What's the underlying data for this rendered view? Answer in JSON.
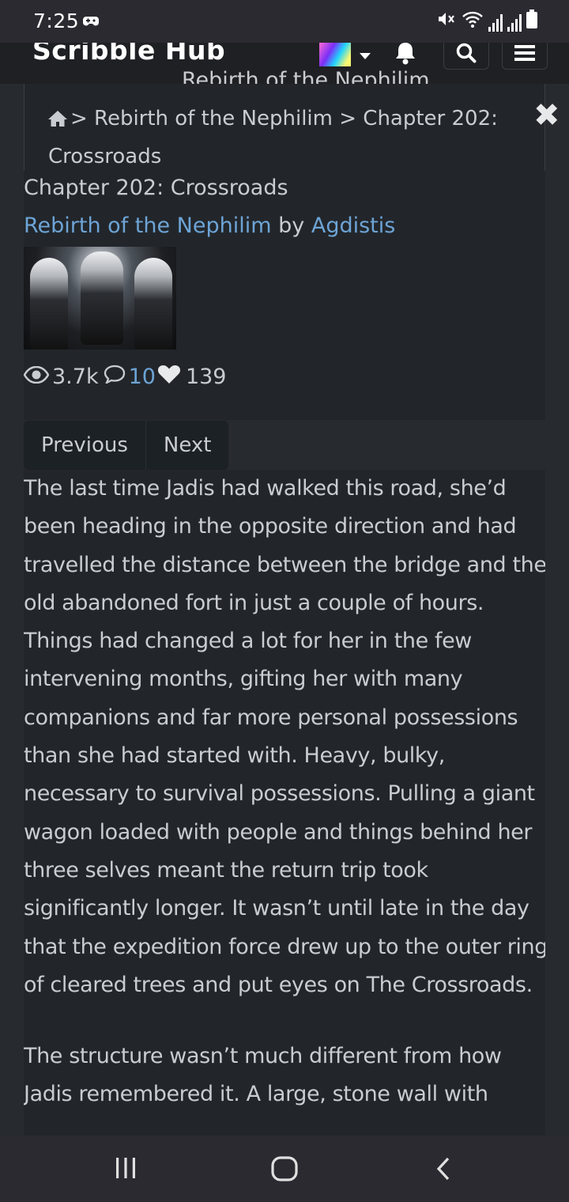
{
  "status": {
    "time": "7:25"
  },
  "header": {
    "brand": "Scribble Hub",
    "ghost_title": "Rebirth of the Nephilim"
  },
  "breadcrumb": {
    "text": "> Rebirth of the Nephilim > Chapter 202: Crossroads"
  },
  "chapter": {
    "title": "Chapter 202: Crossroads",
    "series_link": "Rebirth of the Nephilim",
    "by": "by",
    "author_link": "Agdistis",
    "views": "3.7k",
    "comments": "10",
    "favorites": "139"
  },
  "nav": {
    "previous": "Previous",
    "next": "Next"
  },
  "content": {
    "p1": "The last time Jadis had walked this road, she’d been heading in the opposite direction and had travelled the distance between the bridge and the old abandoned fort in just a couple of hours. Things had changed a lot for her in the few intervening months, gifting her with many companions and far more personal possessions than she had started with. Heavy, bulky, necessary to survival possessions. Pulling a giant wagon loaded with people and things behind her three selves meant the return trip took significantly longer. It wasn’t until late in the day that the expedition force drew up to the outer ring of cleared trees and put eyes on The Crossroads.",
    "p2": "The structure wasn’t much different from how Jadis remembered it. A large, stone wall with"
  },
  "colors": {
    "link": "#6da4d6",
    "panel": "#22262b",
    "background": "#272a2e"
  }
}
